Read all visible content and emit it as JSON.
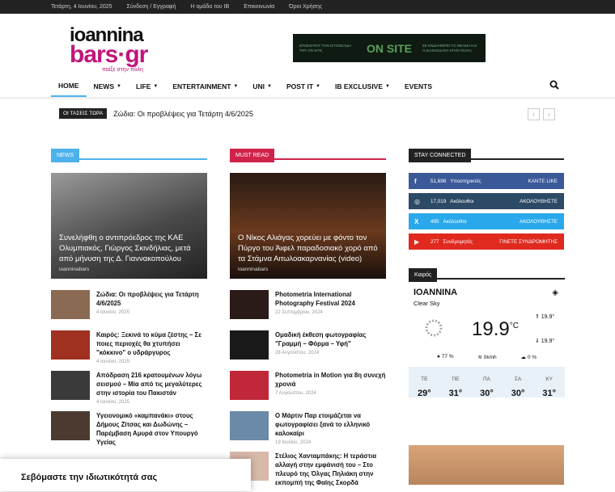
{
  "topbar": {
    "date": "Τετάρτη, 4 Ιουνίου, 2025",
    "links": [
      "Σύνδεση / Εγγραφή",
      "Η ομάδα του IB",
      "Επικοινωνία",
      "Όροι Χρήσης"
    ]
  },
  "logo": {
    "line1": "ioannina",
    "line2": "bars·gr",
    "tagline": "παίξε στην πόλη"
  },
  "banner": {
    "left": "ΕΠΙΣΚΕΨΟΥ ΤΗΝ ΙΣΤΟΣΕΛΙΔΑ ΤΟΥ ON SITE",
    "center": "ON SITE",
    "right": "ΣΕ ΕΝΔΙΑΦΕΡΕΙ ΤΟ ΘΕΑΜΑ ΚΑΙ Η ΔΙΑΣΚΕΔΑΣΗ ΣΤΗΝ ΠΟΛΗ;"
  },
  "nav": [
    {
      "label": "HOME",
      "caret": false
    },
    {
      "label": "NEWS",
      "caret": true
    },
    {
      "label": "LIFE",
      "caret": true
    },
    {
      "label": "ENTERTAINMENT",
      "caret": true
    },
    {
      "label": "UNI",
      "caret": true
    },
    {
      "label": "POST IT",
      "caret": true
    },
    {
      "label": "IB EXCLUSIVE",
      "caret": true
    },
    {
      "label": "EVENTS",
      "caret": false
    }
  ],
  "ticker": {
    "tag": "ΟΙ ΤΑΣΕΙΣ ΤΩΡΑ",
    "text": "Ζώδια: Οι προβλέψεις για Τετάρτη 4/6/2025"
  },
  "news": {
    "heading": "NEWS",
    "color": "#4db2ec",
    "featured": {
      "title": "Συνελήφθη ο αντιπρόεδρος της ΚΑΕ Ολυμπιακός, Γιώργος Σκινδήλιας, μετά από μήνυση της Δ. Γιαννακοπούλου",
      "author": "ioanninabars"
    },
    "items": [
      {
        "title": "Ζώδια: Οι προβλέψεις για Τετάρτη 4/6/2025",
        "date": "4 Ιουνίου, 2025",
        "thumb": "#8a6a52"
      },
      {
        "title": "Καιρός: Ξεκινά το κύμα ζέστης – Σε ποιες περιοχές θα χτυπήσει \"κόκκινο\" ο υδράργυρος",
        "date": "4 Ιουνίου, 2025",
        "thumb": "#a03020"
      },
      {
        "title": "Απόδραση 216 κρατουμένων λόγω σεισμού – Μία από τις μεγαλύτερες στην ιστορία του Πακιστάν",
        "date": "4 Ιουνίου, 2025",
        "thumb": "#3a3a3a"
      },
      {
        "title": "Υγειονομικό «καμπανάκι» στους Δήμους Ζίτσας και Δωδώνης – Παρέμβαση Αμυρά στον Υπουργό Υγείας",
        "date": "",
        "thumb": "#4a3a30"
      }
    ]
  },
  "mustread": {
    "heading": "MUST READ",
    "color": "#d0234a",
    "featured": {
      "title": "Ο Νίκος Αλιάγας χορεύει με φόντο τον Πύργο του Άιφελ παραδοσιακό χορό από τα Στάμνα Αιτωλοακαρνανίας (video)",
      "author": "ioanninabars"
    },
    "items": [
      {
        "title": "Photometria International Photography Festival 2024",
        "date": "22 Σεπτεμβρίου, 2024",
        "thumb": "#2a1a18"
      },
      {
        "title": "Ομαδική έκθεση φωτογραφίας \"Γραμμή – Φόρμα – Υφή\"",
        "date": "28 Αυγούστου, 2024",
        "thumb": "#1a1a1a"
      },
      {
        "title": "Photometria in Motion για 8η συνεχή χρονιά",
        "date": "7 Αυγούστου, 2024",
        "thumb": "#c0283a"
      },
      {
        "title": "Ο Μάρτιν Παρ ετοιμάζεται να φωτογραφίσει ξανά το ελληνικό καλοκαίρι",
        "date": "19 Ιουλίου, 2024",
        "thumb": "#6a8aa8"
      },
      {
        "title": "Στέλιος Χανταμπάκης: Η τεράστια αλλαγή στην εμφάνισή του – Στο πλευρό της Όλγας Πηλιάκη στην εκπομπή της Φαίης Σκορδά",
        "date": "",
        "thumb": "#d8b8a8"
      }
    ]
  },
  "stay": {
    "heading": "STAY CONNECTED",
    "rows": [
      {
        "icon": "f",
        "count": "51,698",
        "label": "Υποστηρικτές",
        "action": "ΚΑΝΤΕ LIKE",
        "color": "#3b5998"
      },
      {
        "icon": "◎",
        "count": "17,019",
        "label": "Ακόλουθοι",
        "action": "ΑΚΟΛΟΥΘΗΣΤΕ",
        "color": "#2c4a66"
      },
      {
        "icon": "X",
        "count": "495",
        "label": "Ακόλουθοι",
        "action": "ΑΚΟΛΟΥΘΗΣΤΕ",
        "color": "#29a9eb"
      },
      {
        "icon": "▶",
        "count": "277",
        "label": "Συνδρομητές",
        "action": "ΓΙΝΕΤΕ ΣΥΝΔΡΟΜΗΤΗΣ",
        "color": "#e02a20"
      }
    ]
  },
  "weather": {
    "heading": "Καιρός",
    "city": "ΙΟΑΝΝΙΝΑ",
    "sky": "Clear Sky",
    "temp": "19.9",
    "unit": "°C",
    "high": "19.9°",
    "low": "19.9°",
    "humidity": "77 %",
    "wind": "0kmh",
    "clouds": "0 %",
    "days": [
      {
        "name": "ΤΕ",
        "temp": "29°"
      },
      {
        "name": "ΠΕ",
        "temp": "31°"
      },
      {
        "name": "ΠΑ",
        "temp": "30°"
      },
      {
        "name": "ΣΑ",
        "temp": "30°"
      },
      {
        "name": "ΚΥ",
        "temp": "31°"
      }
    ]
  },
  "popup": {
    "text": "Σεβόμαστε την ιδιωτικότητά σας"
  }
}
